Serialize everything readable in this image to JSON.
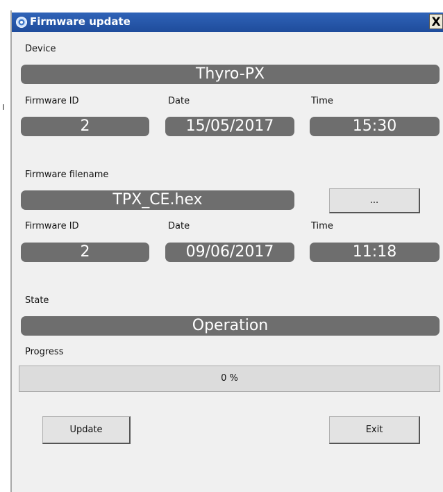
{
  "window": {
    "title": "Firmware update",
    "close_label": "X"
  },
  "device": {
    "label": "Device",
    "value": "Thyro-PX"
  },
  "current": {
    "id_label": "Firmware ID",
    "id": "2",
    "date_label": "Date",
    "date": "15/05/2017",
    "time_label": "Time",
    "time": "15:30"
  },
  "file": {
    "label": "Firmware filename",
    "name": "TPX_CE.hex",
    "browse_label": "..."
  },
  "new_fw": {
    "id_label": "Firmware ID",
    "id": "2",
    "date_label": "Date",
    "date": "09/06/2017",
    "time_label": "Time",
    "time": "11:18"
  },
  "state": {
    "label": "State",
    "value": "Operation"
  },
  "progress": {
    "label": "Progress",
    "text": "0 %",
    "percent": 0
  },
  "buttons": {
    "update_label": "Update",
    "exit_label": "Exit"
  },
  "colors": {
    "titlebar": "#2454a8",
    "field_bg": "#6e6e6e",
    "window_bg": "#f0f0f0"
  }
}
